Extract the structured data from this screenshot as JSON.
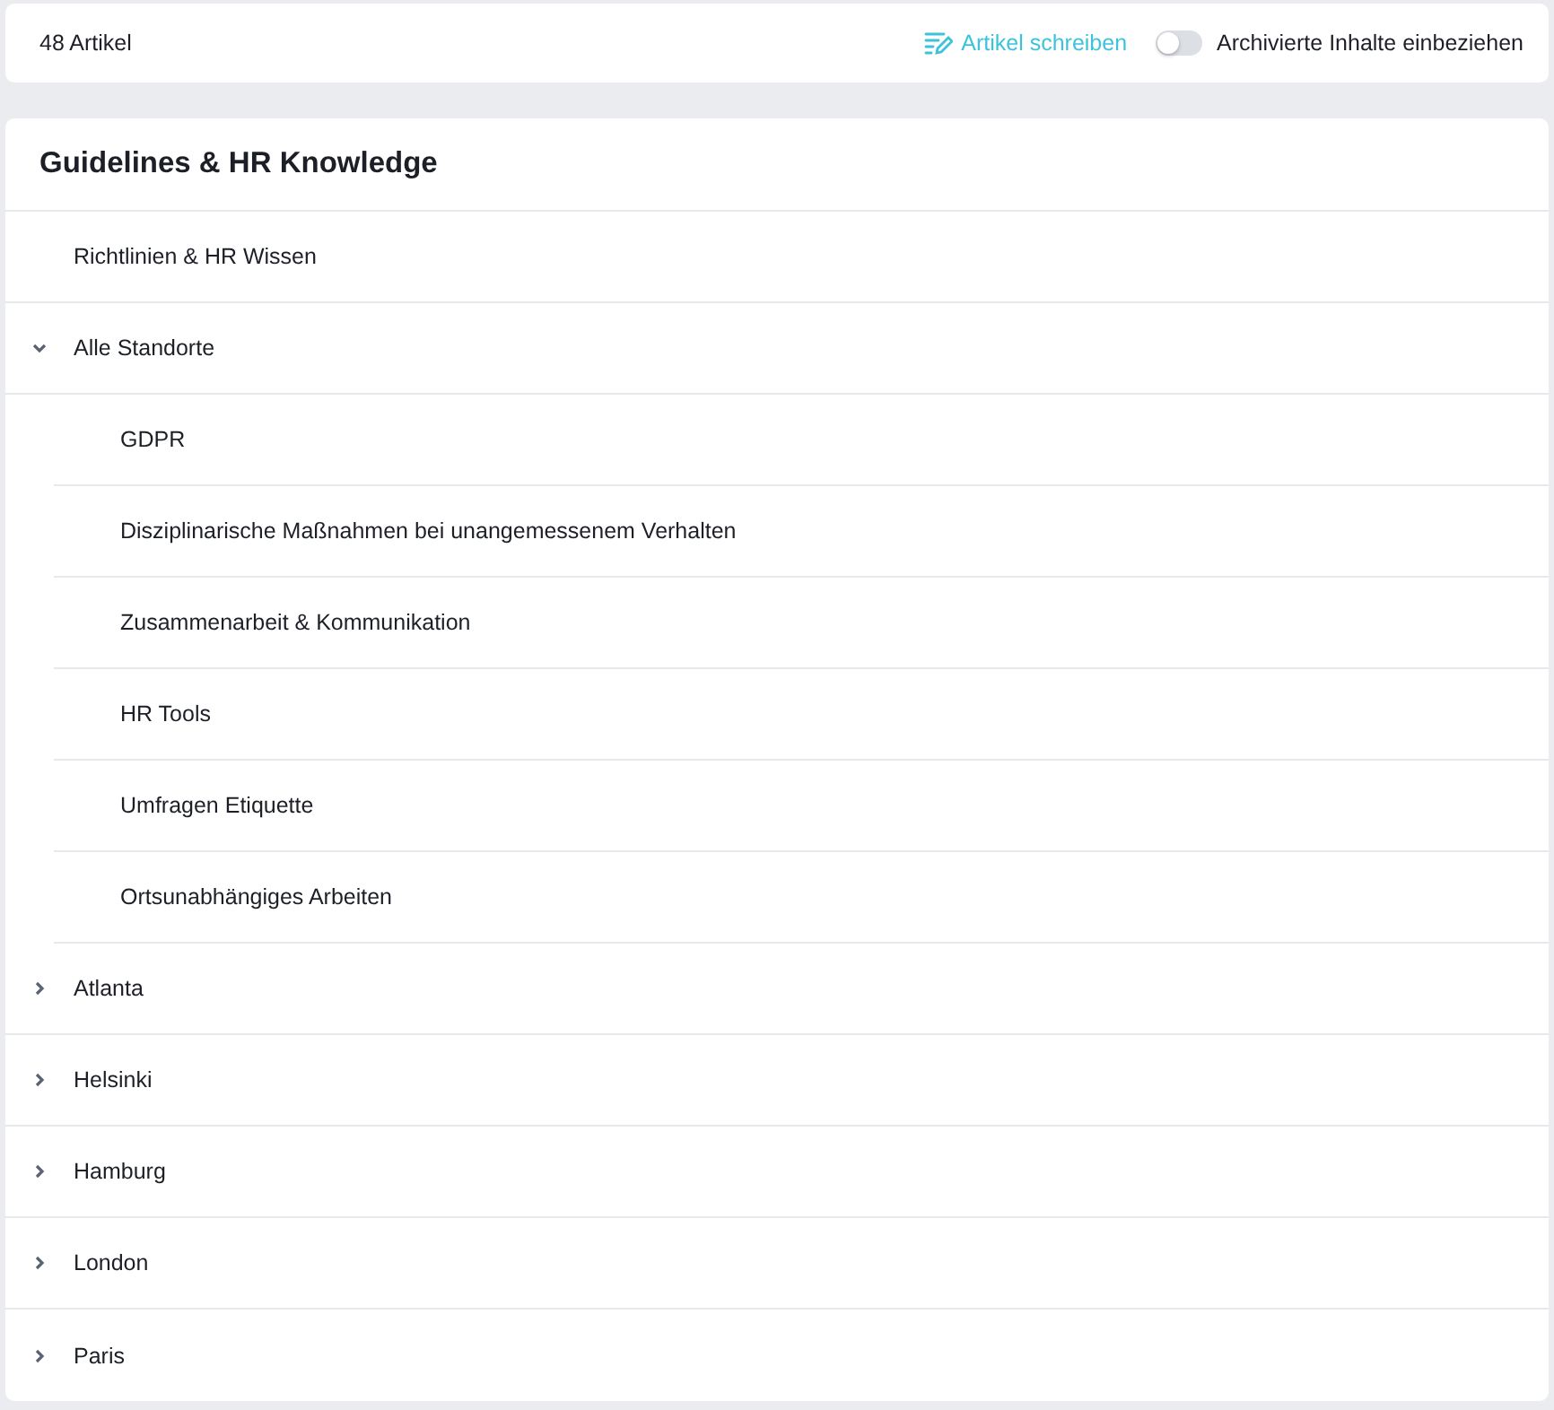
{
  "toolbar": {
    "count": "48 Artikel",
    "write_link": "Artikel schreiben",
    "archive_toggle": {
      "label": "Archivierte Inhalte einbeziehen",
      "on": false
    }
  },
  "section": {
    "title": "Guidelines & HR Knowledge",
    "items": [
      {
        "kind": "article",
        "label": "Richtlinien & HR Wissen"
      },
      {
        "kind": "folder",
        "label": "Alle Standorte",
        "expanded": true,
        "children": [
          {
            "label": "GDPR"
          },
          {
            "label": "Disziplinarische Maßnahmen bei unangemessenem Verhalten"
          },
          {
            "label": "Zusammenarbeit & Kommunikation"
          },
          {
            "label": "HR Tools"
          },
          {
            "label": "Umfragen Etiquette"
          },
          {
            "label": "Ortsunabhängiges Arbeiten"
          }
        ]
      },
      {
        "kind": "folder",
        "label": "Atlanta",
        "expanded": false
      },
      {
        "kind": "folder",
        "label": "Helsinki",
        "expanded": false
      },
      {
        "kind": "folder",
        "label": "Hamburg",
        "expanded": false
      },
      {
        "kind": "folder",
        "label": "London",
        "expanded": false
      },
      {
        "kind": "folder",
        "label": "Paris",
        "expanded": false
      }
    ]
  }
}
